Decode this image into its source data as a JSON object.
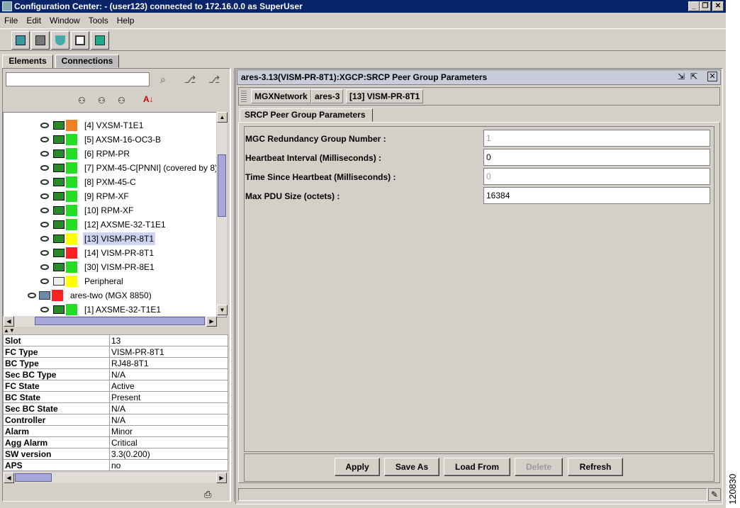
{
  "window": {
    "title": "Configuration Center: - (user123) connected to 172.16.0.0 as SuperUser"
  },
  "menu": [
    "File",
    "Edit",
    "Window",
    "Tools",
    "Help"
  ],
  "tabs": [
    "Elements",
    "Connections"
  ],
  "tree": {
    "rows": [
      {
        "label": "[4] VXSM-T1E1",
        "status": "#f08020",
        "card": true
      },
      {
        "label": "[5] AXSM-16-OC3-B",
        "status": "#22dd22",
        "card": true
      },
      {
        "label": "[6] RPM-PR",
        "status": "#22dd22",
        "card": true
      },
      {
        "label": "[7] PXM-45-C[PNNI] (covered by 8)",
        "status": "#22dd22",
        "card": true
      },
      {
        "label": "[8] PXM-45-C",
        "status": "#22dd22",
        "card": true
      },
      {
        "label": "[9] RPM-XF",
        "status": "#22dd22",
        "card": true
      },
      {
        "label": "[10] RPM-XF",
        "status": "#22dd22",
        "card": true
      },
      {
        "label": "[12] AXSME-32-T1E1",
        "status": "#22dd22",
        "card": true
      },
      {
        "label": "[13] VISM-PR-8T1",
        "status": "#ffff00",
        "card": true,
        "selected": true
      },
      {
        "label": "[14] VISM-PR-8T1",
        "status": "#ff2020",
        "card": true
      },
      {
        "label": "[30] VISM-PR-8E1",
        "status": "#22dd22",
        "card": true
      },
      {
        "label": "Peripheral",
        "status": "#ffff00",
        "card": false
      },
      {
        "label": "ares-two (MGX 8850)",
        "status": "#ff2020",
        "card": false,
        "node": true
      },
      {
        "label": "[1] AXSME-32-T1E1",
        "status": "#22dd22",
        "card": true
      }
    ]
  },
  "properties": [
    {
      "k": "Slot",
      "v": "13"
    },
    {
      "k": "FC Type",
      "v": "VISM-PR-8T1"
    },
    {
      "k": "BC Type",
      "v": "RJ48-8T1"
    },
    {
      "k": "Sec BC Type",
      "v": "N/A"
    },
    {
      "k": "FC State",
      "v": "Active"
    },
    {
      "k": "BC State",
      "v": "Present"
    },
    {
      "k": "Sec BC State",
      "v": "N/A"
    },
    {
      "k": "Controller",
      "v": "N/A"
    },
    {
      "k": "Alarm",
      "v": "Minor"
    },
    {
      "k": "Agg Alarm",
      "v": "Critical"
    },
    {
      "k": "SW version",
      "v": "3.3(0.200)"
    },
    {
      "k": "APS",
      "v": "no"
    }
  ],
  "right": {
    "title": "ares-3.13(VISM-PR-8T1):XGCP:SRCP Peer Group Parameters",
    "breadcrumb": [
      "MGXNetwork",
      "ares-3",
      "[13] VISM-PR-8T1"
    ],
    "subtab": "SRCP Peer Group Parameters",
    "fields": [
      {
        "label": "MGC Redundancy Group Number :",
        "value": "1",
        "disabled": true
      },
      {
        "label": "Heartbeat Interval (Milliseconds) :",
        "value": "0",
        "disabled": false
      },
      {
        "label": "Time Since Heartbeat (Milliseconds) :",
        "value": "0",
        "disabled": true
      },
      {
        "label": "Max PDU Size (octets) :",
        "value": "16384",
        "disabled": false
      }
    ],
    "buttons": {
      "apply": "Apply",
      "save_as": "Save As",
      "load_from": "Load From",
      "delete": "Delete",
      "refresh": "Refresh"
    }
  },
  "figure_id": "120830"
}
